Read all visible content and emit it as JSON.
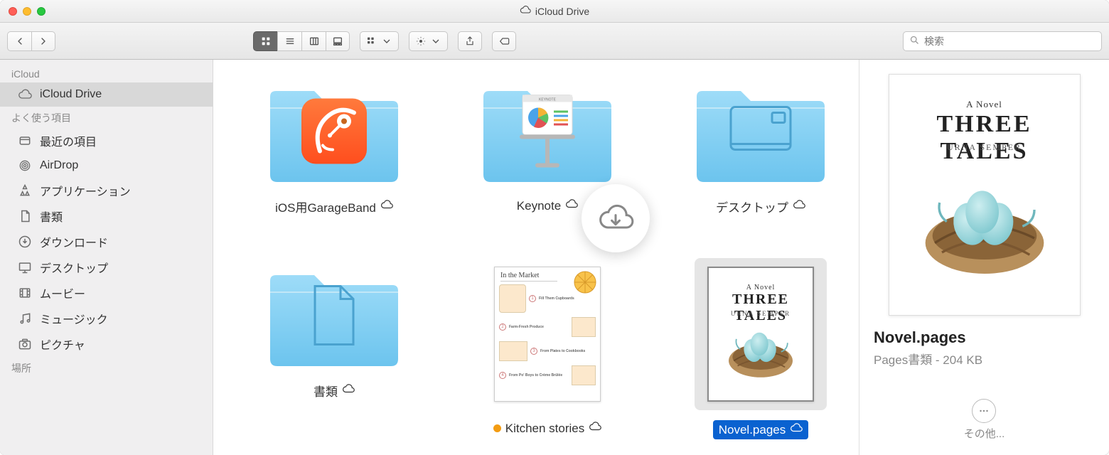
{
  "window": {
    "title": "iCloud Drive"
  },
  "search": {
    "placeholder": "検索"
  },
  "sidebar": {
    "sections": [
      {
        "title": "iCloud",
        "items": [
          {
            "label": "iCloud Drive",
            "selected": true,
            "icon": "cloud"
          }
        ]
      },
      {
        "title": "よく使う項目",
        "items": [
          {
            "label": "最近の項目",
            "icon": "recents"
          },
          {
            "label": "AirDrop",
            "icon": "airdrop"
          },
          {
            "label": "アプリケーション",
            "icon": "apps"
          },
          {
            "label": "書類",
            "icon": "documents"
          },
          {
            "label": "ダウンロード",
            "icon": "downloads"
          },
          {
            "label": "デスクトップ",
            "icon": "desktop"
          },
          {
            "label": "ムービー",
            "icon": "movies"
          },
          {
            "label": "ミュージック",
            "icon": "music"
          },
          {
            "label": "ピクチャ",
            "icon": "pictures"
          }
        ]
      },
      {
        "title": "場所",
        "items": []
      }
    ]
  },
  "items": [
    {
      "name": "iOS用GarageBand",
      "type": "folder",
      "overlay": "garageband",
      "cloud": true
    },
    {
      "name": "Keynote",
      "type": "folder",
      "overlay": "keynote",
      "cloud": true
    },
    {
      "name": "デスクトップ",
      "type": "folder",
      "overlay": "desktop-generic",
      "cloud": true
    },
    {
      "name": "書類",
      "type": "folder",
      "overlay": "document-generic",
      "cloud": true
    },
    {
      "name": "Kitchen stories",
      "type": "document",
      "overlay": "kitchen",
      "cloud": true,
      "tag": "orange"
    },
    {
      "name": "Novel.pages",
      "type": "document",
      "overlay": "threetales",
      "cloud": true,
      "selected": true
    }
  ],
  "cover": {
    "subtitle": "A Novel",
    "title": "THREE TALES",
    "author": "URNA SEMPER"
  },
  "kitchen": {
    "title": "In the Market",
    "c1": "Fill Them Cupboards",
    "c2": "Farm-Fresh Produce",
    "c3": "From Plates to Cookbooks",
    "c4": "From Po' Boys to Crème Brûlée"
  },
  "preview": {
    "filename": "Novel.pages",
    "meta": "Pages書類 - 204 KB",
    "more": "その他..."
  }
}
